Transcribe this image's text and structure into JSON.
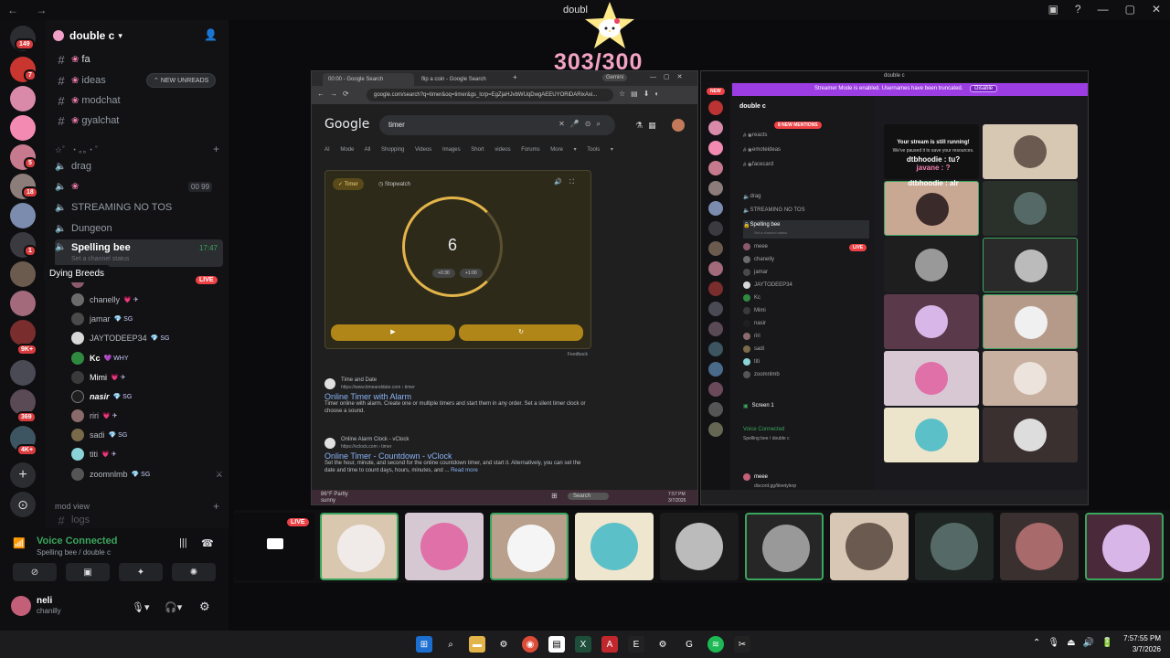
{
  "window": {
    "title": "doubl",
    "nav": "← →",
    "controls": [
      "▣",
      "?",
      "—",
      "▢",
      "✕"
    ]
  },
  "counter": {
    "text": "303/300"
  },
  "rail": {
    "badges": [
      "149",
      "7",
      "5",
      "18",
      "1",
      "9K+",
      "369",
      "4K+"
    ],
    "add_icon": "+",
    "discover_icon": "⊙"
  },
  "guild": {
    "name": "double c",
    "new_unreads": "NEW UNREADS",
    "channels": [
      {
        "name": "fa",
        "type": "text"
      },
      {
        "name": "ideas",
        "type": "text"
      },
      {
        "name": "modchat",
        "type": "text"
      },
      {
        "name": "gyalchat",
        "type": "text"
      }
    ],
    "category_1": "☆゜・。。・゜",
    "voice": [
      {
        "name": "drag"
      },
      {
        "name": "",
        "counter": "00",
        "counter2": "99"
      },
      {
        "name": "STREAMING NO TOS"
      },
      {
        "name": "Dungeon"
      },
      {
        "name": "Spelling bee",
        "time": "17:47",
        "status": "Set a channel status"
      }
    ],
    "tooltip": "Dying Breeds",
    "live_label": "LIVE",
    "members": [
      {
        "name": "",
        "tag": ""
      },
      {
        "name": "chanelly",
        "tag": "💗 ✈"
      },
      {
        "name": "jamar",
        "tag": "💎 SG"
      },
      {
        "name": "JAYTODEEP34",
        "tag": "💎 SG"
      },
      {
        "name": "Kc",
        "tag": "💜 WHY"
      },
      {
        "name": "Mimi",
        "tag": "💗 ✈"
      },
      {
        "name": "nasir",
        "tag": "💎 SG"
      },
      {
        "name": "riri",
        "tag": "💗 ✈"
      },
      {
        "name": "sadi",
        "tag": "💎 SG"
      },
      {
        "name": "titi",
        "tag": "💗 ✈"
      },
      {
        "name": "zoomnlmb",
        "tag": "💎 SG"
      }
    ],
    "category_2": "mod view",
    "logs": "logs"
  },
  "user_panel": {
    "voice_connected": "Voice Connected",
    "channel_path": "Spelling bee / double c",
    "username": "neli",
    "status": "chanilly"
  },
  "browser": {
    "tab1": "00:00 - Google Search",
    "tab2": "flip a coin - Google Search",
    "gemini": "Gemini",
    "url": "google.com/search?q=timer&oq=timer&gs_lcrp=EgZjaHJvbWUqDwgAEEUYORiDARixAxi...",
    "logo": "Google",
    "query": "timer",
    "tabs": "AI Mode  All  Shopping  Videos  Images  Short videos  Forums  More ▾  Tools ▾",
    "timer_label": "Timer",
    "stopwatch_label": "Stopwatch",
    "timer_value": "6",
    "plus30": "+0:30",
    "plus1": "+1:00",
    "play": "▶",
    "reset": "↻",
    "feedback": "Feedback",
    "results": [
      {
        "site": "Time and Date",
        "url": "https://www.timeanddate.com › timer",
        "title": "Online Timer with Alarm",
        "snippet": "Timer online with alarm. Create one or multiple timers and start them in any order. Set a silent timer clock or choose a sound."
      },
      {
        "site": "Online Alarm Clock - vClock",
        "url": "https://vclock.com › timer",
        "title": "Online Timer - Countdown - vClock",
        "snippet": "Set the hour, minute, and second for the online countdown timer, and start it. Alternatively, you can set the date and time to count days, hours, minutes, and ...",
        "read_more": "Read more"
      }
    ],
    "weather": "86°F Partly sunny",
    "search": "Search",
    "clock": "7:57 PM 3/7/2026"
  },
  "mini": {
    "title": "double c",
    "banner": "Streamer Mode is enabled. Usernames have been truncated.",
    "disable": "Disable",
    "guild": "double c",
    "new_mentions": "8 NEW MENTIONS",
    "channels": [
      "reacts",
      "emoteideas",
      "facecard"
    ],
    "voice": [
      "drag",
      "STREAMING NO TOS",
      "Spelling bee"
    ],
    "status": "Set a channel status",
    "members": [
      "meee",
      "chanelly",
      "jamar",
      "JAYTODEEP34",
      "Kc",
      "Mimi",
      "nasir",
      "riri",
      "sadi",
      "titi",
      "zoomnlmb"
    ],
    "live_label": "LIVE",
    "new_label": "NEW",
    "screen": "Screen 1",
    "voice_connected": "Voice Connected",
    "vc_path": "Spelling bee / double c",
    "user": "meee",
    "user_status": "discord.gg/bleetylerp",
    "stream_msg": "Your stream is still running!",
    "stream_sub": "We've paused it to save your resources.",
    "chat1": "dtbhoodie : tu?",
    "chat2": "javane : ?",
    "chat3": "dtbhoodie : alr"
  },
  "strip": {
    "live_label": "LIVE"
  },
  "taskbar": {
    "time": "7:57:55 PM",
    "date": "3/7/2026"
  },
  "colors": {
    "accent_green": "#3ba55d",
    "live_red": "#ed4245",
    "counter_pink": "#f2a3c2",
    "timer_gold": "#e3b449",
    "streamer_banner": "#9b3de2"
  }
}
